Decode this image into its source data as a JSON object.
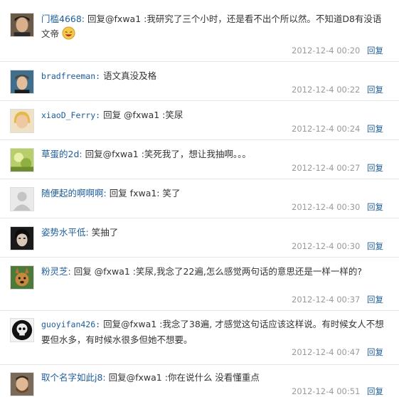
{
  "colors": {
    "username": "#1d5c99",
    "text": "#333333",
    "timestamp": "#9a9a9a",
    "divider": "#e6e6e6"
  },
  "comments": [
    {
      "username": "门槛4668:",
      "text": "回复@fxwa1 :我研究了三个小时，还是看不出个所以然。不知道D8有没语文帝",
      "emoticon": "laughing-emoticon-icon",
      "time": "2012-12-4 00:20",
      "reply": "回复",
      "avatar": "avatar-man-dark-hair"
    },
    {
      "username": "bradfreeman:",
      "text": "语文真没及格",
      "time": "2012-12-4 00:22",
      "reply": "回复",
      "avatar": "avatar-boy"
    },
    {
      "username": "xiaoD_Ferry:",
      "text": "回复 @fxwa1 :笑尿",
      "time": "2012-12-4 00:24",
      "reply": "回复",
      "avatar": "avatar-blonde"
    },
    {
      "username": "草蛋的2d:",
      "text": "回复@fxwa1 :笑死我了，想让我抽啊。。。",
      "time": "2012-12-4 00:27",
      "reply": "回复",
      "avatar": "avatar-green"
    },
    {
      "username": "随便起的啊啊啊:",
      "text": "回复 fxwa1: 笑了",
      "time": "2012-12-4 00:30",
      "reply": "回复",
      "avatar": "avatar-default"
    },
    {
      "username": "姿势水平低:",
      "text": "笑抽了",
      "time": "2012-12-4 00:30",
      "reply": "回复",
      "avatar": "avatar-dark-face"
    },
    {
      "username": "粉灵芝:",
      "text": "回复 @fxwa1 :笑尿,我念了22遍,怎么感觉两句话的意思还是一样一样的?",
      "time": "2012-12-4 00:37",
      "reply": "回复",
      "avatar": "avatar-dog"
    },
    {
      "username": "guoyifan426:",
      "text": "回复@fxwa1 :我念了38遍, 才感觉这句话应该这样说。有时候女人不想要但水多，有时候水很多但她不想要。",
      "time": "2012-12-4 00:47",
      "reply": "回复",
      "avatar": "avatar-skull"
    },
    {
      "username": "取个名字如此j8:",
      "text": "回复@fxwa1 :你在说什么 没看懂重点",
      "time": "2012-12-4 00:51",
      "reply": "回复",
      "avatar": "avatar-man-beard"
    }
  ]
}
